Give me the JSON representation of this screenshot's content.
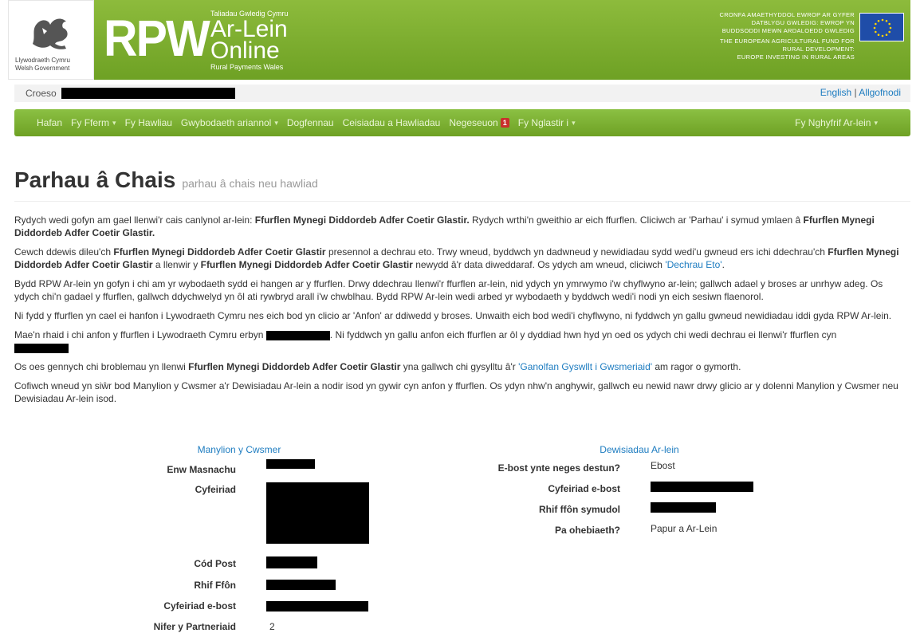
{
  "header": {
    "gov_logo_line1": "Llywodraeth Cymru",
    "gov_logo_line2": "Welsh Government",
    "rpw": "RPW",
    "rpw_small": "Taliadau Gwledig Cymru",
    "rpw_big1": "Ar-Lein",
    "rpw_big2": "Online",
    "rpw_sub": "Rural Payments Wales",
    "eu_lines": [
      "CRONFA AMAETHYDDOL EWROP AR GYFER",
      "DATBLYGU GWLEDIG: EWROP YN",
      "BUDDSODDI MEWN ARDALOEDD GWLEDIG",
      "THE EUROPEAN AGRICULTURAL FUND FOR",
      "RURAL DEVELOPMENT:",
      "EUROPE INVESTING IN RURAL AREAS"
    ]
  },
  "welcome": {
    "greeting": "Croeso",
    "english": "English",
    "separator": "|",
    "logout": "Allgofnodi"
  },
  "nav": {
    "items": [
      {
        "label": "Hafan",
        "caret": false
      },
      {
        "label": "Fy Fferm",
        "caret": true
      },
      {
        "label": "Fy Hawliau",
        "caret": false
      },
      {
        "label": "Gwybodaeth ariannol",
        "caret": true
      },
      {
        "label": "Dogfennau",
        "caret": false
      },
      {
        "label": "Ceisiadau a Hawliadau",
        "caret": false
      },
      {
        "label": "Negeseuon",
        "caret": false
      },
      {
        "label": "Fy Nglastir i",
        "caret": true
      }
    ],
    "messages_badge": "1",
    "account": "Fy Nghyfrif Ar-lein"
  },
  "page": {
    "title": "Parhau â Chais",
    "subtitle": "parhau â chais neu hawliad"
  },
  "paragraphs": {
    "p1a": "Rydych wedi gofyn am gael llenwi'r cais canlynol ar-lein: ",
    "form_name": "Ffurflen Mynegi Diddordeb Adfer Coetir Glastir.",
    "p1b": " Rydych wrthi'n gweithio ar eich ffurflen. Cliciwch ar 'Parhau' i symud ymlaen â ",
    "p2a": "Cewch ddewis dileu'ch ",
    "form_name_short": "Ffurflen Mynegi Diddordeb Adfer Coetir Glastir",
    "p2b": " presennol a dechrau eto. Trwy wneud, byddwch yn dadwneud y newidiadau sydd wedi'u gwneud ers ichi ddechrau'ch ",
    "p2c": " a llenwir y ",
    "p2d": " newydd â'r data diweddaraf. Os ydych am wneud, cliciwch ",
    "p2_link": "'Dechrau Eto'",
    "p2e": ".",
    "p3": "Bydd RPW Ar-lein yn gofyn i chi am yr wybodaeth sydd ei hangen ar y ffurflen. Drwy ddechrau llenwi'r ffurflen ar-lein, nid ydych yn ymrwymo i'w chyflwyno ar-lein; gallwch adael y broses ar unrhyw adeg. Os ydych chi'n gadael y ffurflen, gallwch ddychwelyd yn ôl ati rywbryd arall i'w chwblhau. Bydd RPW Ar-lein wedi arbed yr wybodaeth y byddwch wedi'i nodi yn eich sesiwn flaenorol.",
    "p4": "Ni fydd y ffurflen yn cael ei hanfon i Lywodraeth Cymru nes eich bod yn clicio ar 'Anfon' ar ddiwedd y broses. Unwaith eich bod wedi'i chyflwyno, ni fyddwch yn gallu gwneud newidiadau iddi gyda RPW Ar-lein.",
    "p5a": "Mae'n rhaid i chi anfon y ffurflen i Lywodraeth Cymru erbyn ",
    "p5b": ". Ni fyddwch yn gallu anfon eich ffurflen ar ôl y dyddiad hwn hyd yn oed os ydych chi wedi dechrau ei llenwi'r ffurflen cyn",
    "p6a": "Os oes gennych chi broblemau yn llenwi ",
    "p6b": " yna gallwch chi gysylltu â'r ",
    "p6_link": "'Ganolfan Gyswllt i Gwsmeriaid'",
    "p6c": " am ragor o gymorth.",
    "p7": "Cofiwch wneud yn siŵr bod Manylion y Cwsmer a'r Dewisiadau Ar-lein a nodir isod yn gywir cyn anfon y ffurflen. Os ydyn nhw'n anghywir, gallwch eu newid nawr drwy glicio ar y dolenni Manylion y Cwsmer neu Dewisiadau Ar-lein isod."
  },
  "customer": {
    "heading": "Manylion y Cwsmer",
    "trading_name": "Enw Masnachu",
    "address": "Cyfeiriad",
    "postcode": "Cód Post",
    "phone": "Rhif Ffôn",
    "email": "Cyfeiriad e-bost",
    "partners": "Nifer y Partneriaid",
    "partners_value": "2"
  },
  "online": {
    "heading": "Dewisiadau Ar-lein",
    "email_or_text": "E-bost ynte neges destun?",
    "email_or_text_value": "Ebost",
    "email_address": "Cyfeiriad e-bost",
    "mobile": "Rhif ffôn symudol",
    "correspondence": "Pa ohebiaeth?",
    "correspondence_value": "Papur a Ar-Lein"
  }
}
